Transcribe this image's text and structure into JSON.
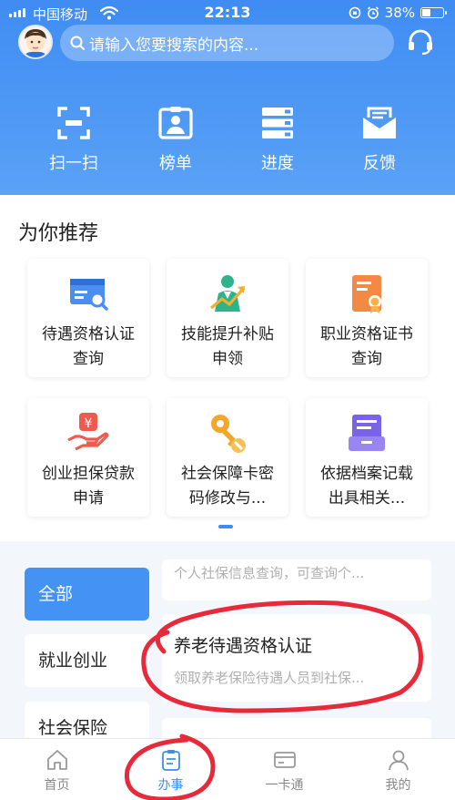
{
  "status_bar": {
    "carrier": "中国移动",
    "time": "22:13",
    "battery": "38%",
    "battery_level": 0.38
  },
  "header": {
    "search_placeholder": "请输入您要搜索的内容...",
    "quick_actions": [
      {
        "label": "扫一扫",
        "icon": "scan-icon"
      },
      {
        "label": "榜单",
        "icon": "ranking-icon"
      },
      {
        "label": "进度",
        "icon": "progress-icon"
      },
      {
        "label": "反馈",
        "icon": "feedback-icon"
      }
    ]
  },
  "recommend": {
    "title": "为你推荐",
    "cards": [
      {
        "label": "待遇资格认证查询",
        "icon": "certification-query-icon"
      },
      {
        "label": "技能提升补贴申领",
        "icon": "skill-subsidy-icon"
      },
      {
        "label": "职业资格证书查询",
        "icon": "certificate-icon"
      },
      {
        "label": "创业担保贷款申请",
        "icon": "loan-icon"
      },
      {
        "label": "社会保障卡密码修改与...",
        "icon": "key-icon"
      },
      {
        "label": "依据档案记载出具相关...",
        "icon": "archive-icon"
      }
    ]
  },
  "categories": {
    "items": [
      "全部",
      "就业创业",
      "社会保险"
    ],
    "active": "全部"
  },
  "services": [
    {
      "title": "",
      "desc": "个人社保信息查询，可查询个..."
    },
    {
      "title": "养老待遇资格认证",
      "desc": "领取养老保险待遇人员到社保..."
    }
  ],
  "tabbar": {
    "items": [
      "首页",
      "办事",
      "一卡通",
      "我的"
    ],
    "active": "办事"
  },
  "colors": {
    "primary": "#3f8cf2",
    "annotation": "#e8293a"
  }
}
